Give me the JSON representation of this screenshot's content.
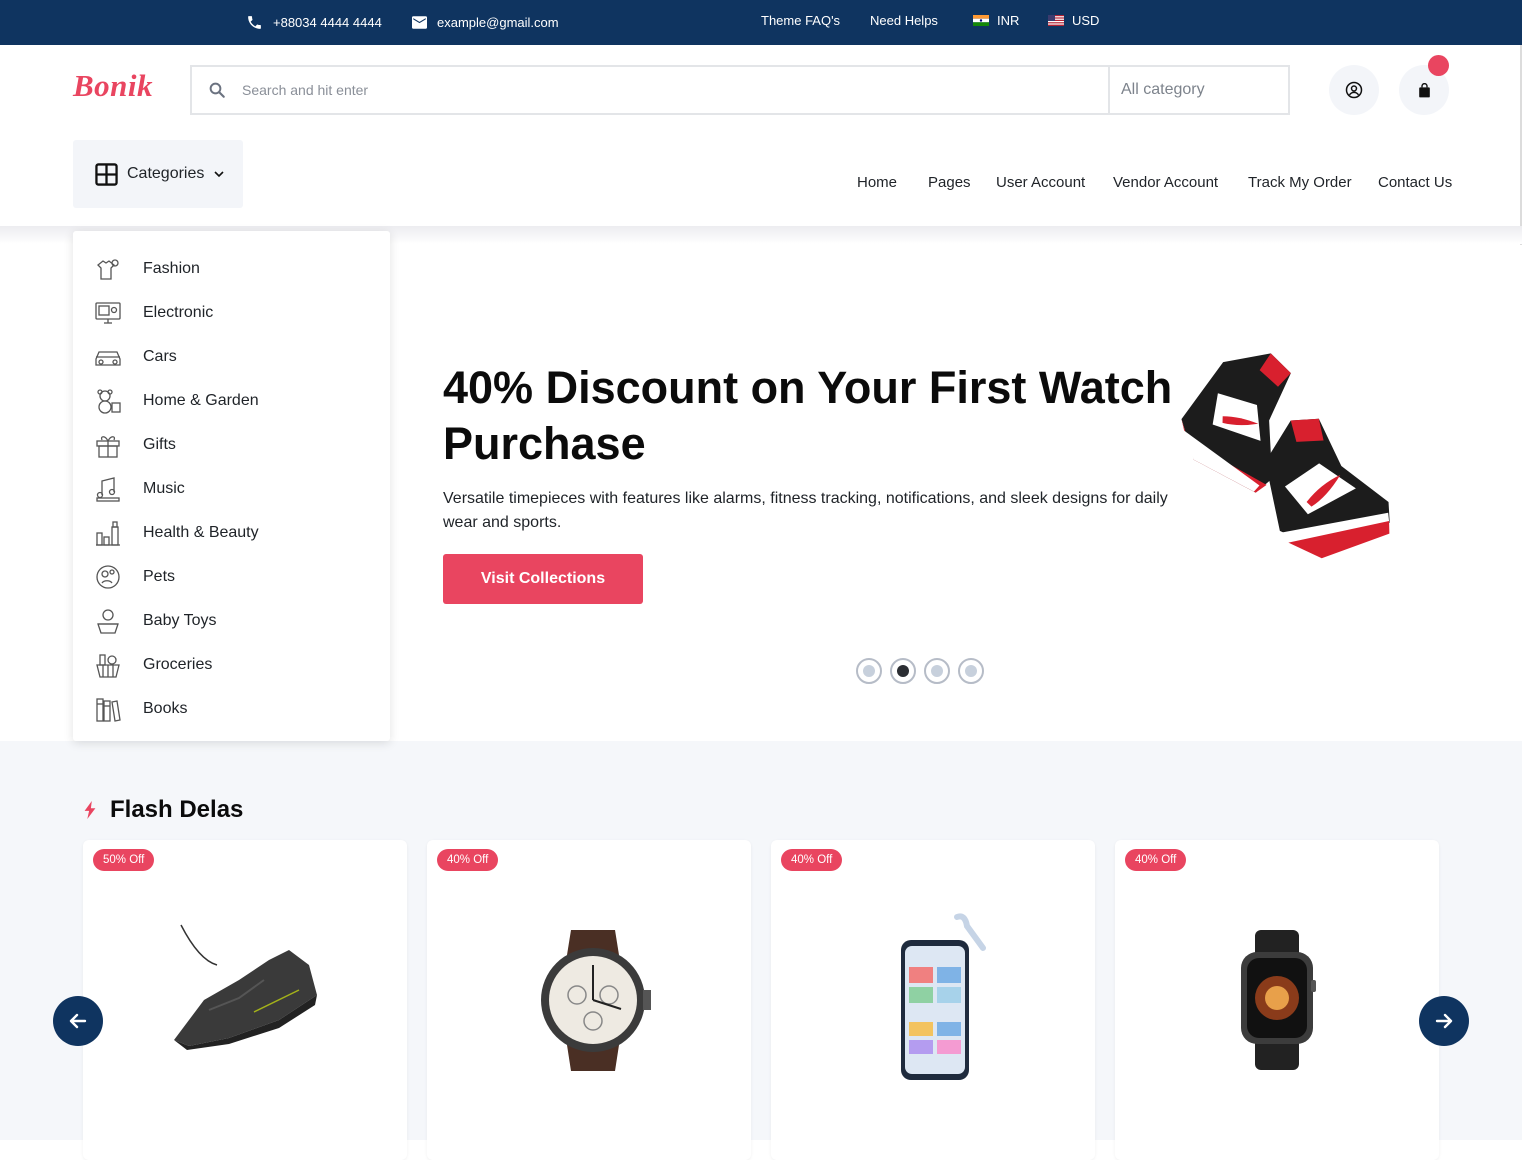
{
  "topbar": {
    "phone": "+88034 4444 4444",
    "email": "example@gmail.com",
    "links": [
      "Theme FAQ's",
      "Need Helps"
    ],
    "currency_inr": "INR",
    "currency_usd": "USD"
  },
  "header": {
    "logo": "Bonik",
    "search_placeholder": "Search and hit enter",
    "search_category": "All category",
    "categories_button": "Categories",
    "nav": [
      "Home",
      "Pages",
      "User Account",
      "Vendor Account",
      "Track My Order",
      "Contact Us"
    ]
  },
  "category_menu": [
    {
      "label": "Fashion",
      "icon": "fashion-icon"
    },
    {
      "label": "Electronic",
      "icon": "monitor-icon"
    },
    {
      "label": "Cars",
      "icon": "car-icon"
    },
    {
      "label": "Home & Garden",
      "icon": "teddy-bear-icon"
    },
    {
      "label": "Gifts",
      "icon": "gift-icon"
    },
    {
      "label": "Music",
      "icon": "music-icon"
    },
    {
      "label": "Health & Beauty",
      "icon": "beauty-icon"
    },
    {
      "label": "Pets",
      "icon": "pet-icon"
    },
    {
      "label": "Baby Toys",
      "icon": "baby-icon"
    },
    {
      "label": "Groceries",
      "icon": "basket-icon"
    },
    {
      "label": "Books",
      "icon": "books-icon"
    }
  ],
  "hero": {
    "title": "40% Discount on Your First Watch Purchase",
    "description": "Versatile timepieces with features like alarms, fitness tracking, notifications, and sleek designs for daily wear and sports.",
    "cta": "Visit Collections",
    "active_slide": 2,
    "slide_count": 4
  },
  "flash_deals": {
    "title": "Flash Delas",
    "products": [
      {
        "badge": "50% Off",
        "image": "sneaker-image"
      },
      {
        "badge": "40% Off",
        "image": "watch-image"
      },
      {
        "badge": "40% Off",
        "image": "smartphone-image"
      },
      {
        "badge": "40% Off",
        "image": "smartwatch-image"
      }
    ]
  },
  "colors": {
    "primary": "#e94560",
    "navy": "#0f3460",
    "light_bg": "#f5f7fa"
  }
}
